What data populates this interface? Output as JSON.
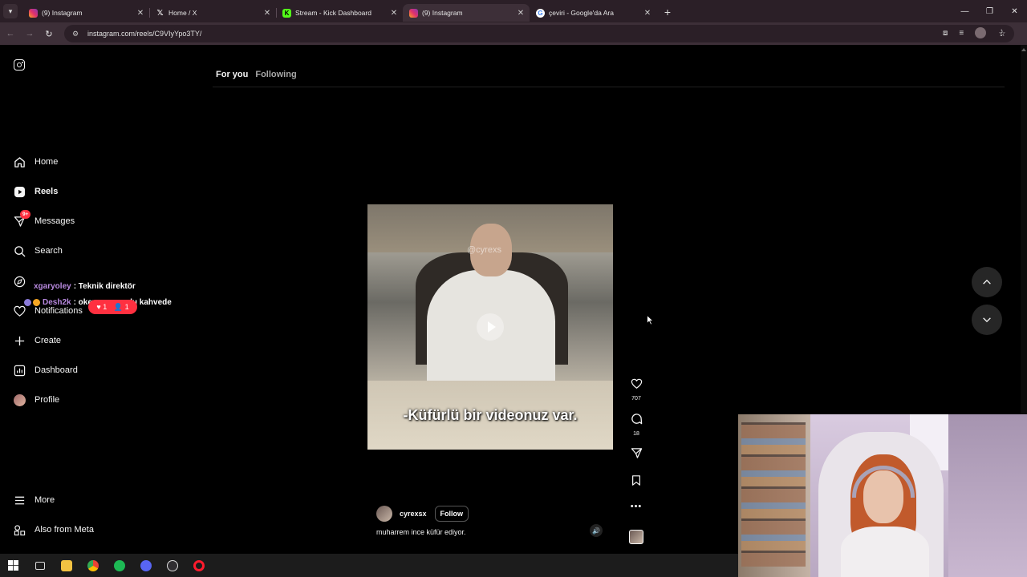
{
  "browser": {
    "tabs": [
      {
        "title": "(9) Instagram",
        "icon": "instagram-icon",
        "active": false
      },
      {
        "title": "Home / X",
        "icon": "x-icon",
        "active": false
      },
      {
        "title": "Stream - Kick Dashboard",
        "icon": "kick-icon",
        "active": false
      },
      {
        "title": "(9) Instagram",
        "icon": "instagram-icon",
        "active": true
      },
      {
        "title": "çeviri - Google'da Ara",
        "icon": "google-icon",
        "active": false
      }
    ],
    "url": "instagram.com/reels/C9VIyYpo3TY/"
  },
  "sidebar": {
    "items": [
      {
        "label": "Home",
        "icon": "home-icon"
      },
      {
        "label": "Reels",
        "icon": "reels-icon"
      },
      {
        "label": "Messages",
        "icon": "messages-icon",
        "badge": "9+"
      },
      {
        "label": "Search",
        "icon": "search-icon"
      },
      {
        "label": "Explore",
        "icon": "explore-icon"
      },
      {
        "label": "Notifications",
        "icon": "heart-icon"
      },
      {
        "label": "Create",
        "icon": "plus-icon"
      },
      {
        "label": "Dashboard",
        "icon": "dashboard-icon"
      },
      {
        "label": "Profile",
        "icon": "avatar-icon"
      }
    ],
    "more": "More",
    "also_from_meta": "Also from Meta",
    "notification_pill": {
      "likes": "1",
      "follows": "1"
    }
  },
  "chat_overlay": {
    "line1_user": "xgaryoley",
    "line1_text": ": Teknik direktör",
    "line2_user": "Desh2k",
    "line2_text": ": okey oynuyodu kahvede"
  },
  "feed_tabs": {
    "for_you": "For you",
    "following": "Following"
  },
  "reel": {
    "watermark": "@cyrexs",
    "subtitle": "-Küfürlü bir videonuz var.",
    "author": "cyrexsx",
    "follow_label": "Follow",
    "caption": "muharrem ince küfür ediyor.",
    "likes": "707",
    "comments": "18"
  },
  "colors": {
    "accent_red": "#ff3040",
    "background": "#000000",
    "chrome": "#3d2f38"
  }
}
